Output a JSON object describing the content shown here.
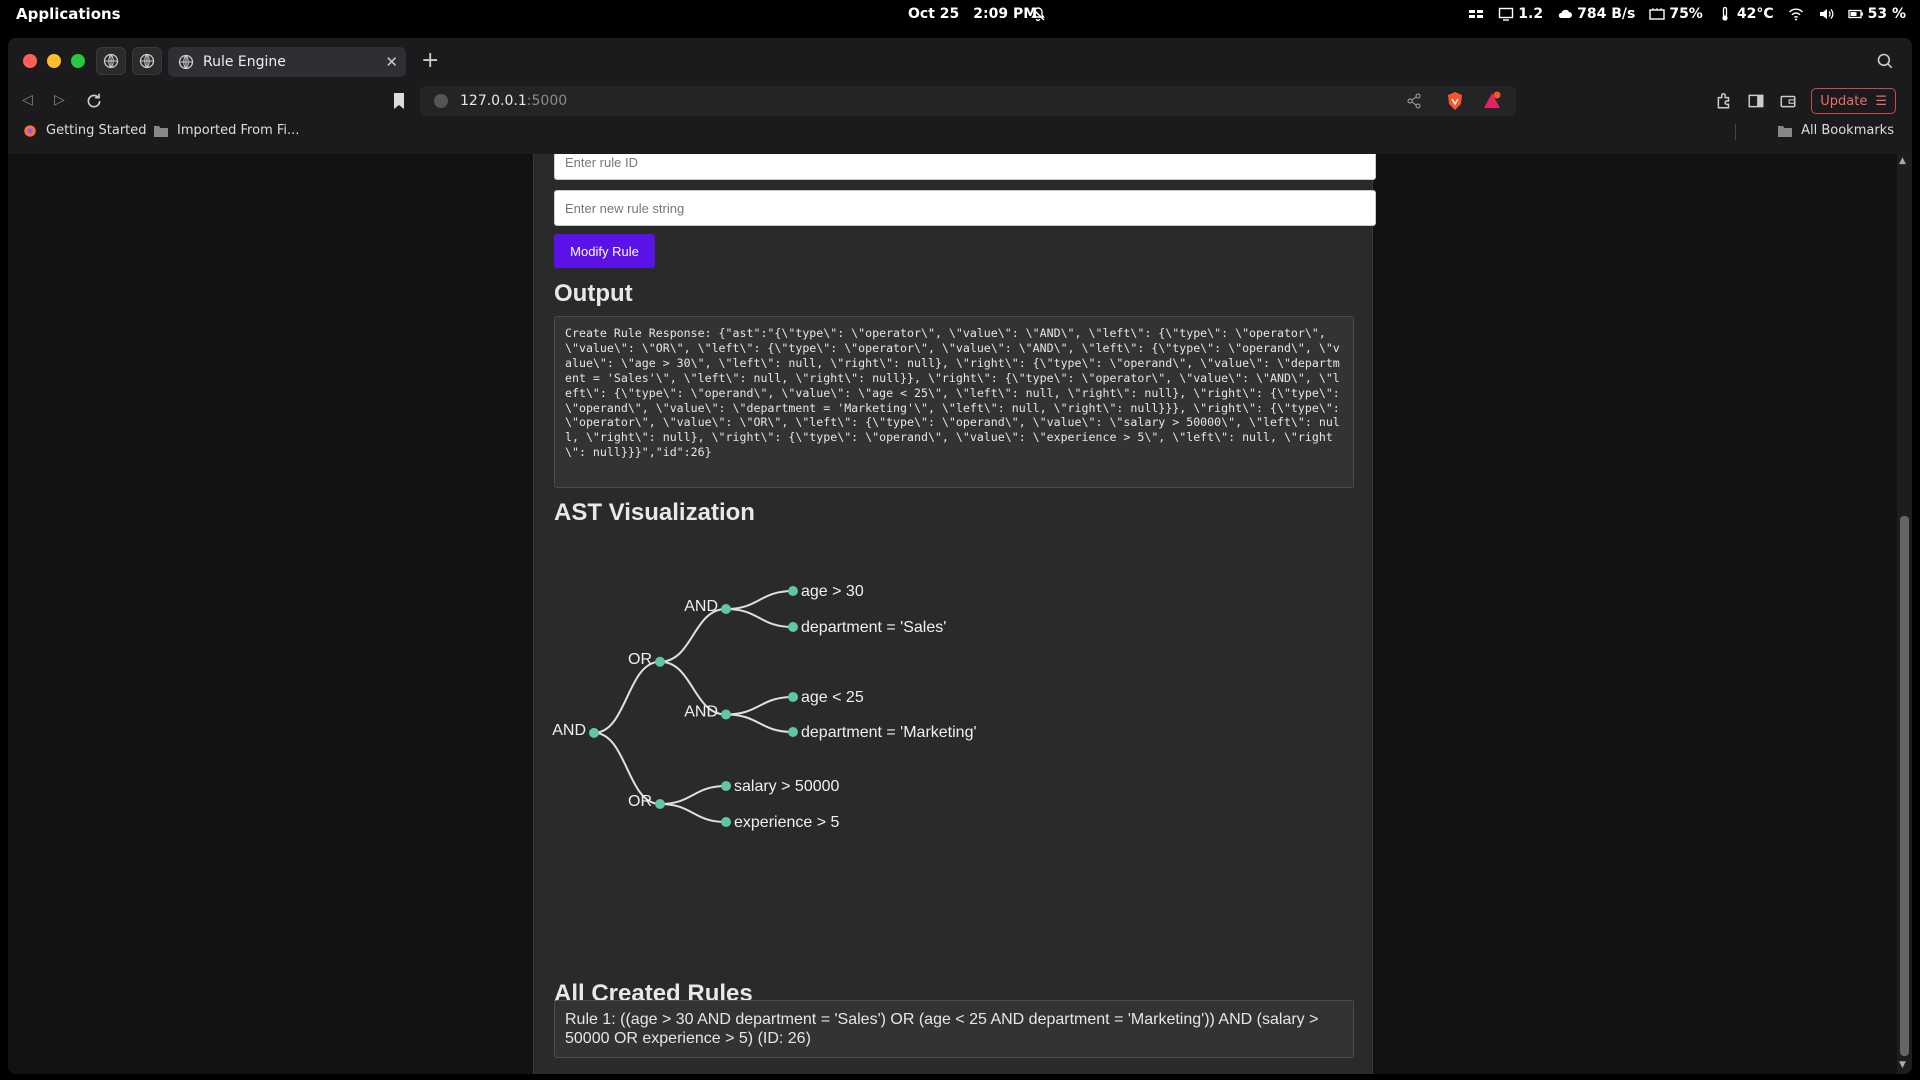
{
  "os": {
    "apps_label": "Applications",
    "date": "Oct 25",
    "time": "2:09 PM",
    "load": "1.2",
    "net": "784 B/s",
    "cpu": "75%",
    "temp": "42°C",
    "battery": "53 %"
  },
  "browser": {
    "tab_title": "Rule Engine",
    "url_host": "127.0.0.1",
    "url_port": ":5000",
    "update_label": "Update",
    "bookmarks": [
      "Getting Started",
      "Imported From Fi..."
    ],
    "all_bookmarks": "All Bookmarks"
  },
  "page": {
    "rule_id_placeholder": "Enter rule ID",
    "rule_string_placeholder": "Enter new rule string",
    "modify_button": "Modify Rule",
    "output_heading": "Output",
    "output_text": "Create Rule Response: {\"ast\":\"{\\\"type\\\": \\\"operator\\\", \\\"value\\\": \\\"AND\\\", \\\"left\\\": {\\\"type\\\": \\\"operator\\\", \\\"value\\\": \\\"OR\\\", \\\"left\\\": {\\\"type\\\": \\\"operator\\\", \\\"value\\\": \\\"AND\\\", \\\"left\\\": {\\\"type\\\": \\\"operand\\\", \\\"value\\\": \\\"age > 30\\\", \\\"left\\\": null, \\\"right\\\": null}, \\\"right\\\": {\\\"type\\\": \\\"operand\\\", \\\"value\\\": \\\"department = 'Sales'\\\", \\\"left\\\": null, \\\"right\\\": null}}, \\\"right\\\": {\\\"type\\\": \\\"operator\\\", \\\"value\\\": \\\"AND\\\", \\\"left\\\": {\\\"type\\\": \\\"operand\\\", \\\"value\\\": \\\"age < 25\\\", \\\"left\\\": null, \\\"right\\\": null}, \\\"right\\\": {\\\"type\\\": \\\"operand\\\", \\\"value\\\": \\\"department = 'Marketing'\\\", \\\"left\\\": null, \\\"right\\\": null}}}, \\\"right\\\": {\\\"type\\\": \\\"operator\\\", \\\"value\\\": \\\"OR\\\", \\\"left\\\": {\\\"type\\\": \\\"operand\\\", \\\"value\\\": \\\"salary > 50000\\\", \\\"left\\\": null, \\\"right\\\": null}, \\\"right\\\": {\\\"type\\\": \\\"operand\\\", \\\"value\\\": \\\"experience > 5\\\", \\\"left\\\": null, \\\"right\\\": null}}}\",\"id\":26}",
    "ast_heading": "AST Visualization",
    "ast_tree": {
      "label": "AND",
      "children": [
        {
          "label": "OR",
          "children": [
            {
              "label": "AND",
              "children": [
                {
                  "label": "age > 30"
                },
                {
                  "label": "department = 'Sales'"
                }
              ]
            },
            {
              "label": "AND",
              "children": [
                {
                  "label": "age < 25"
                },
                {
                  "label": "department = 'Marketing'"
                }
              ]
            }
          ]
        },
        {
          "label": "OR",
          "children": [
            {
              "label": "salary > 50000"
            },
            {
              "label": "experience > 5"
            }
          ]
        }
      ]
    },
    "rules_heading": "All Created Rules",
    "rules": [
      "Rule 1: ((age > 30 AND department = 'Sales') OR (age < 25 AND department = 'Marketing')) AND (salary > 50000 OR experience > 5) (ID: 26)"
    ]
  },
  "colors": {
    "accent_button": "#5b12e6",
    "tree_node": "#5fc7a4",
    "card_bg": "#2a2a2a"
  }
}
